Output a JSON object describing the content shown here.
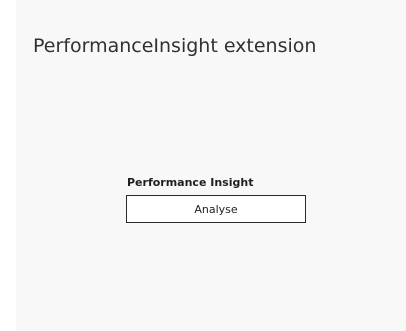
{
  "extension": {
    "title": "PerformanceInsight extension"
  },
  "performance_insight": {
    "label": "Performance Insight",
    "analyse_button_label": "Analyse"
  }
}
